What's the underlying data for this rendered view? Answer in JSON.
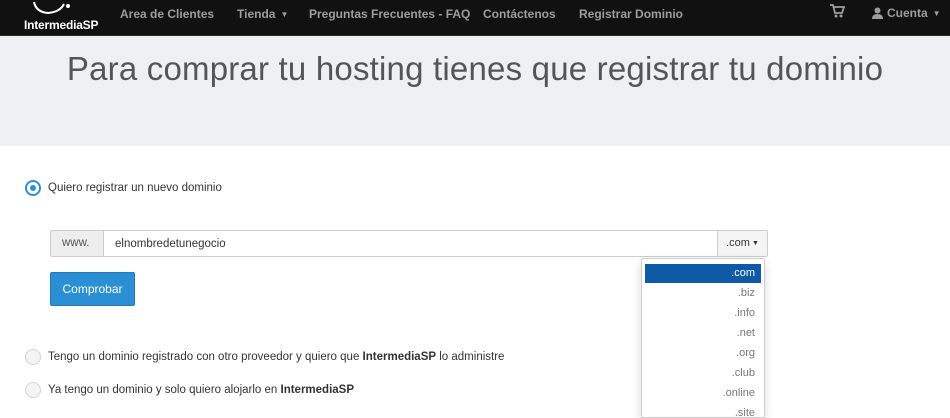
{
  "navbar": {
    "logo_text": "IntermediaSP",
    "items": [
      {
        "label": "Area de Clientes",
        "dropdown": false
      },
      {
        "label": "Tienda",
        "dropdown": true
      },
      {
        "label": "Preguntas Frecuentes - FAQ",
        "dropdown": false
      },
      {
        "label": "Contáctenos",
        "dropdown": false
      },
      {
        "label": "Registrar Dominio",
        "dropdown": false
      }
    ],
    "cart_icon": "shopping-cart-icon",
    "account_icon": "user-icon",
    "account_label": "Cuenta"
  },
  "hero": {
    "title": "Para comprar tu hosting tienes que registrar tu dominio"
  },
  "options": [
    {
      "label": "Quiero registrar un nuevo dominio",
      "selected": true
    },
    {
      "label_before": "Tengo un dominio registrado con otro proveedor y quiero que ",
      "label_bold": "IntermediaSP",
      "label_after": " lo administre",
      "selected": false
    },
    {
      "label_before": "Ya tengo un dominio y solo quiero alojarlo en ",
      "label_bold": "IntermediaSP",
      "label_after": "",
      "selected": false
    }
  ],
  "domain_form": {
    "prefix": "www.",
    "value": "elnombredetunegocio",
    "tld_selected": ".com",
    "tld_options": [
      ".com",
      ".biz",
      ".info",
      ".net",
      ".org",
      ".club",
      ".online",
      ".site"
    ],
    "submit_label": "Comprobar"
  },
  "colors": {
    "navbar_bg": "#111111",
    "hero_bg": "#eef0f4",
    "accent": "#2b8fd6",
    "dropdown_active": "#0f59a6"
  }
}
